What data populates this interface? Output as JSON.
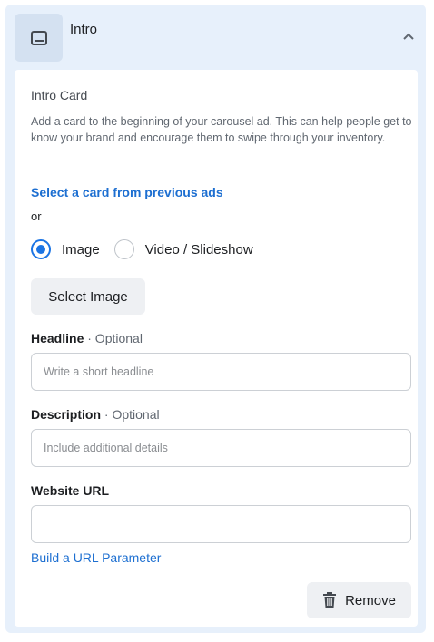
{
  "header": {
    "title": "Intro",
    "icon": "card-icon",
    "toggle_icon": "chevron-up-icon"
  },
  "intro_card": {
    "title": "Intro Card",
    "help_text": "Add a card to the beginning of your carousel ad. This can help people get to know your brand and encourage them to swipe through your inventory.",
    "select_previous_link": "Select a card from previous ads",
    "or_text": "or",
    "media_options": [
      {
        "label": "Image",
        "selected": true
      },
      {
        "label": "Video / Slideshow",
        "selected": false
      }
    ],
    "select_image_label": "Select Image"
  },
  "fields": {
    "headline": {
      "label": "Headline",
      "optional": "· Optional",
      "placeholder": "Write a short headline",
      "value": ""
    },
    "description": {
      "label": "Description",
      "optional": "· Optional",
      "placeholder": "Include additional details",
      "value": ""
    },
    "website_url": {
      "label": "Website URL",
      "placeholder": "",
      "value": ""
    }
  },
  "url_parameter_link": "Build a URL Parameter",
  "remove_label": "Remove",
  "colors": {
    "accent": "#1b74e4",
    "link": "#1d6fd1",
    "panel_bg": "#e7f0fb"
  }
}
